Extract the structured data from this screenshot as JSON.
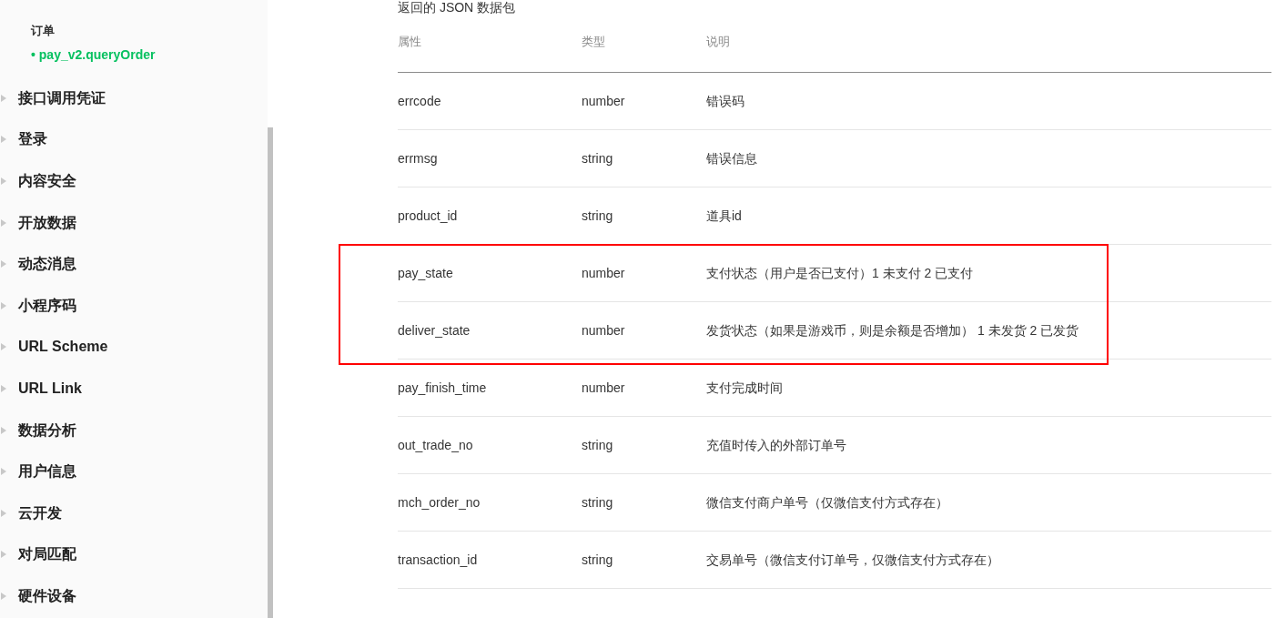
{
  "sidebar": {
    "group_label": "订单",
    "active_link": {
      "bullet": "•",
      "label": "pay_v2.queryOrder",
      "selected": true
    },
    "items": [
      {
        "label": "接口调用凭证",
        "expanded": false
      },
      {
        "label": "登录",
        "expanded": false
      },
      {
        "label": "内容安全",
        "expanded": false
      },
      {
        "label": "开放数据",
        "expanded": false
      },
      {
        "label": "动态消息",
        "expanded": false
      },
      {
        "label": "小程序码",
        "expanded": false
      },
      {
        "label": "URL Scheme",
        "expanded": false
      },
      {
        "label": "URL Link",
        "expanded": false
      },
      {
        "label": "数据分析",
        "expanded": false
      },
      {
        "label": "用户信息",
        "expanded": false
      },
      {
        "label": "云开发",
        "expanded": false
      },
      {
        "label": "对局匹配",
        "expanded": false
      },
      {
        "label": "硬件设备",
        "expanded": false
      }
    ]
  },
  "section_title": "返回的 JSON 数据包",
  "table": {
    "columns": [
      "属性",
      "类型",
      "说明"
    ],
    "rows": [
      {
        "cells": [
          "errcode",
          "number",
          "错误码"
        ],
        "highlighted": false
      },
      {
        "cells": [
          "errmsg",
          "string",
          "错误信息"
        ],
        "highlighted": false
      },
      {
        "cells": [
          "product_id",
          "string",
          "道具id"
        ],
        "highlighted": false
      },
      {
        "cells": [
          "pay_state",
          "number",
          "支付状态（用户是否已支付）1 未支付 2 已支付"
        ],
        "highlighted": true
      },
      {
        "cells": [
          "deliver_state",
          "number",
          "发货状态（如果是游戏币，则是余额是否增加） 1 未发货 2 已发货"
        ],
        "highlighted": true
      },
      {
        "cells": [
          "pay_finish_time",
          "number",
          "支付完成时间"
        ],
        "highlighted": false
      },
      {
        "cells": [
          "out_trade_no",
          "string",
          "充值时传入的外部订单号"
        ],
        "highlighted": false
      },
      {
        "cells": [
          "mch_order_no",
          "string",
          "微信支付商户单号（仅微信支付方式存在）"
        ],
        "highlighted": false
      },
      {
        "cells": [
          "transaction_id",
          "string",
          "交易单号（微信支付订单号，仅微信支付方式存在）"
        ],
        "highlighted": false
      }
    ]
  }
}
